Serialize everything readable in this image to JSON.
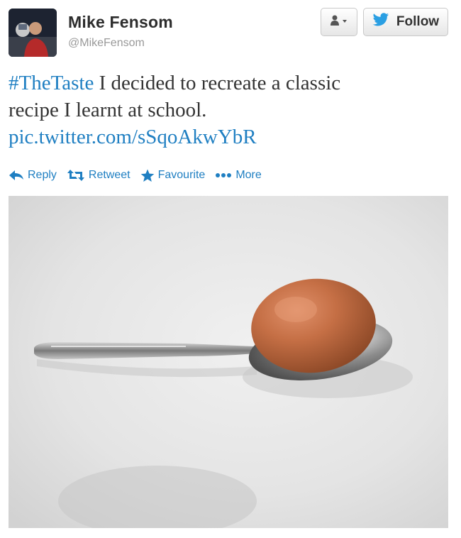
{
  "user": {
    "name": "Mike Fensom",
    "handle": "@MikeFensom"
  },
  "buttons": {
    "follow_label": "Follow"
  },
  "tweet": {
    "hashtag": "#TheTaste",
    "text_line1": " I decided to recreate a classic",
    "text_line2": "recipe I learnt at school.",
    "link": "pic.twitter.com/sSqoAkwYbR"
  },
  "actions": {
    "reply": "Reply",
    "retweet": "Retweet",
    "favourite": "Favourite",
    "more": "More"
  },
  "icons": {
    "avatar": "user-avatar",
    "user_menu": "person-icon",
    "follow": "twitter-bird-icon",
    "reply": "reply-arrow-icon",
    "retweet": "retweet-icon",
    "favourite": "star-icon",
    "more": "ellipsis-icon"
  },
  "colors": {
    "link": "#1f7fc2",
    "text": "#333333",
    "handle": "#999999",
    "name": "#2d2d2d"
  },
  "photo": {
    "subject": "egg-on-spoon"
  }
}
